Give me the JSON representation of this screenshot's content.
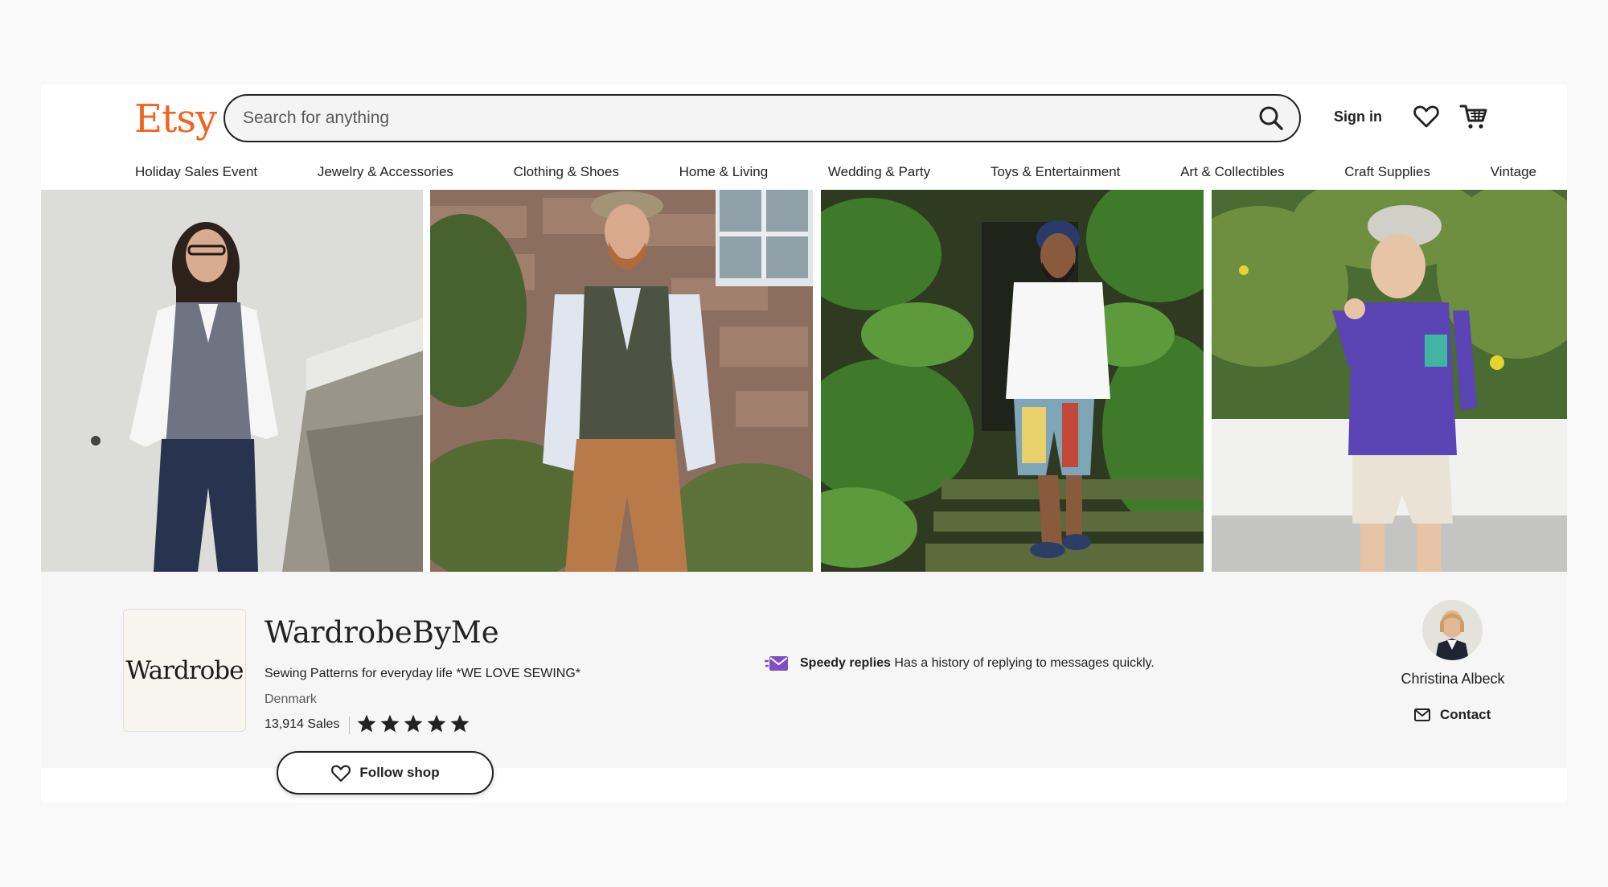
{
  "header": {
    "logo": "Etsy",
    "search_placeholder": "Search for anything",
    "sign_in": "Sign in"
  },
  "nav": {
    "items": [
      "Holiday Sales Event",
      "Jewelry & Accessories",
      "Clothing & Shoes",
      "Home & Living",
      "Wedding & Party",
      "Toys & Entertainment",
      "Art & Collectibles",
      "Craft Supplies",
      "Vintage"
    ]
  },
  "shop": {
    "logo_text": "Wardrobe",
    "name": "WardrobeByMe",
    "tagline": "Sewing Patterns for everyday life *WE LOVE SEWING*",
    "location": "Denmark",
    "sales": "13,914 Sales",
    "rating": 5,
    "follow_label": "Follow shop",
    "speedy_title": "Speedy replies",
    "speedy_text": "Has a history of replying to messages quickly.",
    "owner_name": "Christina Albeck",
    "contact_label": "Contact"
  },
  "icons": {
    "search": "search-icon",
    "favorites": "heart-icon",
    "cart": "cart-icon",
    "star": "star-icon",
    "follow": "heart-outline-icon",
    "speedy": "envelope-speed-icon",
    "contact": "envelope-icon"
  },
  "colors": {
    "brand": "#f1641e",
    "speedy_accent": "#7f4fc4",
    "star": "#222222"
  }
}
